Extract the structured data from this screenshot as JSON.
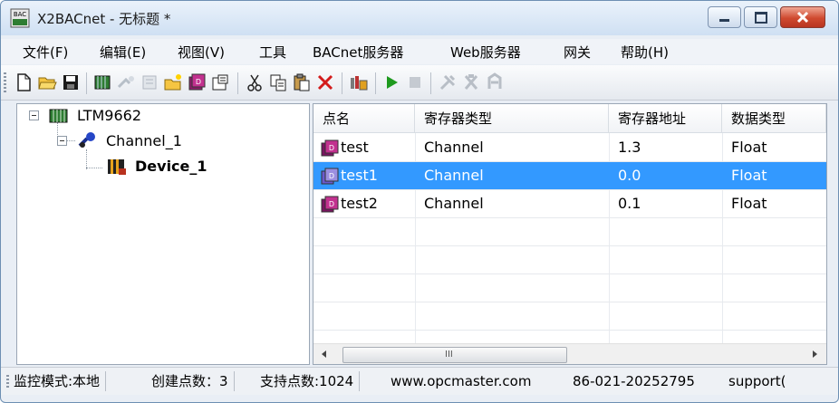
{
  "window": {
    "title": "X2BACnet - 无标题 *",
    "icon_label": "BAC"
  },
  "menu": [
    {
      "label": "文件(F)"
    },
    {
      "label": "编辑(E)"
    },
    {
      "label": "视图(V)"
    },
    {
      "label": "工具"
    },
    {
      "label": "BACnet服务器"
    },
    {
      "label": "Web服务器"
    },
    {
      "label": "网关"
    },
    {
      "label": "帮助(H)"
    }
  ],
  "toolbar": {
    "icons": [
      "new-file-icon",
      "open-folder-icon",
      "save-icon",
      "device-icon",
      "add-channel-icon",
      "add-device-icon",
      "add-folder-icon",
      "add-point-icon",
      "properties-icon",
      "cut-icon",
      "copy-icon",
      "paste-icon",
      "delete-icon",
      "import-icon",
      "run-icon",
      "stop-icon",
      "tools-icon",
      "load-icon",
      "upload-icon"
    ]
  },
  "tree": {
    "root": {
      "label": "LTM9662"
    },
    "channel": {
      "label": "Channel_1"
    },
    "device": {
      "label": "Device_1"
    }
  },
  "table": {
    "columns": [
      "点名",
      "寄存器类型",
      "寄存器地址",
      "数据类型"
    ],
    "rows": [
      {
        "name": "test",
        "reg_type": "Channel",
        "address": "1.3",
        "data_type": "Float",
        "selected": false
      },
      {
        "name": "test1",
        "reg_type": "Channel",
        "address": "0.0",
        "data_type": "Float",
        "selected": true
      },
      {
        "name": "test2",
        "reg_type": "Channel",
        "address": "0.1",
        "data_type": "Float",
        "selected": false
      }
    ],
    "scroll_thumb_label": "III"
  },
  "status": {
    "mode": "监控模式:本地",
    "created_points": "创建点数：3",
    "supported_points": "支持点数:1024",
    "website": "www.opcmaster.com",
    "phone": "86-021-20252795",
    "email_fragment": "support("
  },
  "colors": {
    "selection": "#3399ff",
    "close_button": "#cf4a30",
    "run_green": "#1e9a1e"
  }
}
